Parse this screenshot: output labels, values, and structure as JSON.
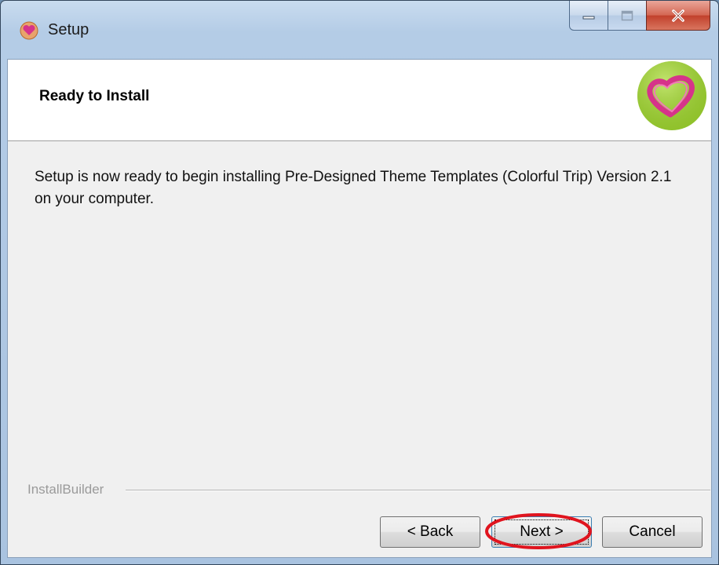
{
  "window": {
    "title": "Setup"
  },
  "header": {
    "title": "Ready to Install"
  },
  "body": {
    "message": "Setup is now ready to begin installing Pre-Designed Theme Templates (Colorful Trip) Version 2.1 on your computer."
  },
  "footer": {
    "branding": "InstallBuilder"
  },
  "buttons": {
    "back": "< Back",
    "next": "Next >",
    "cancel": "Cancel"
  },
  "icons": {
    "app": "heart-app-icon",
    "logo": "heart-logo-icon",
    "minimize": "minimize-icon",
    "maximize": "maximize-icon",
    "close": "close-icon"
  },
  "colors": {
    "logo_green": "#9acd32",
    "heart_pink": "#d6338a",
    "highlight_red": "#e0141e"
  }
}
